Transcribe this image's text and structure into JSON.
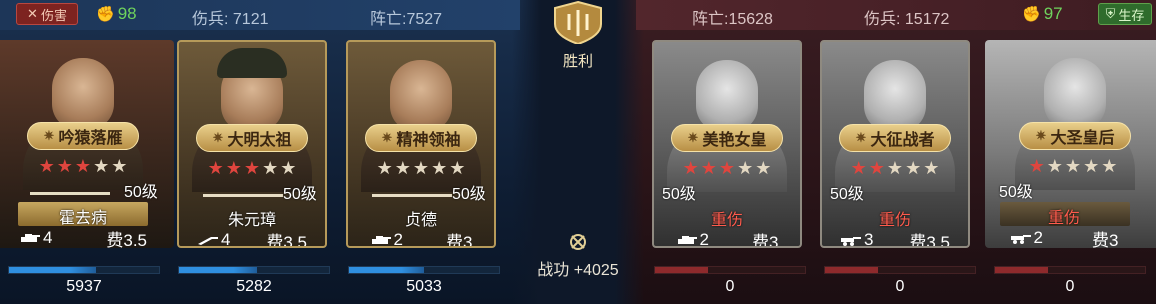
{
  "top": {
    "left": {
      "hurt_tag": "伤害",
      "morale": "98",
      "wounded": "伤兵: 7121",
      "killed": "阵亡:7527"
    },
    "right": {
      "killed": "阵亡:15628",
      "wounded": "伤兵: 15172",
      "morale": "97",
      "alive_tag": "生存"
    }
  },
  "center": {
    "result": "胜利",
    "merit": "战功 +4025"
  },
  "allies": [
    {
      "title": "吟猿落雁",
      "stars": 3,
      "max_stars": 5,
      "level": "50级",
      "name": "霍去病",
      "unit_count": "4",
      "cost": "费3.5",
      "troops": "5937",
      "fill": 0.58,
      "unit_icon": "tank-icon"
    },
    {
      "title": "大明太祖",
      "stars": 3,
      "max_stars": 5,
      "level": "50级",
      "name": "朱元璋",
      "unit_count": "4",
      "cost": "费3.5",
      "troops": "5282",
      "fill": 0.52,
      "unit_icon": "rifle-icon"
    },
    {
      "title": "精神领袖",
      "stars": 0,
      "max_stars": 5,
      "level": "50级",
      "name": "贞德",
      "unit_count": "2",
      "cost": "费3",
      "troops": "5033",
      "fill": 0.5,
      "unit_icon": "tank-icon"
    }
  ],
  "enemies": [
    {
      "title": "美艳女皇",
      "stars": 3,
      "max_stars": 5,
      "level": "50级",
      "status": "重伤",
      "unit_count": "2",
      "cost": "费3",
      "troops": "0",
      "fill": 0.35,
      "unit_icon": "tank-icon"
    },
    {
      "title": "大征战者",
      "stars": 2,
      "max_stars": 5,
      "level": "50级",
      "status": "重伤",
      "unit_count": "3",
      "cost": "费3.5",
      "troops": "0",
      "fill": 0.35,
      "unit_icon": "artillery-icon"
    },
    {
      "title": "大圣皇后",
      "stars": 1,
      "max_stars": 5,
      "level": "50级",
      "status": "重伤",
      "unit_count": "2",
      "cost": "费3",
      "troops": "0",
      "fill": 0.35,
      "unit_icon": "artillery-icon"
    }
  ],
  "colors": {
    "ally_bar": "#2f8fe0",
    "ally_bar_dark": "#1f5d9a",
    "enemy_bar": "#8e2a2c",
    "star_on": "#e0453e",
    "gold": "#c6a760"
  }
}
